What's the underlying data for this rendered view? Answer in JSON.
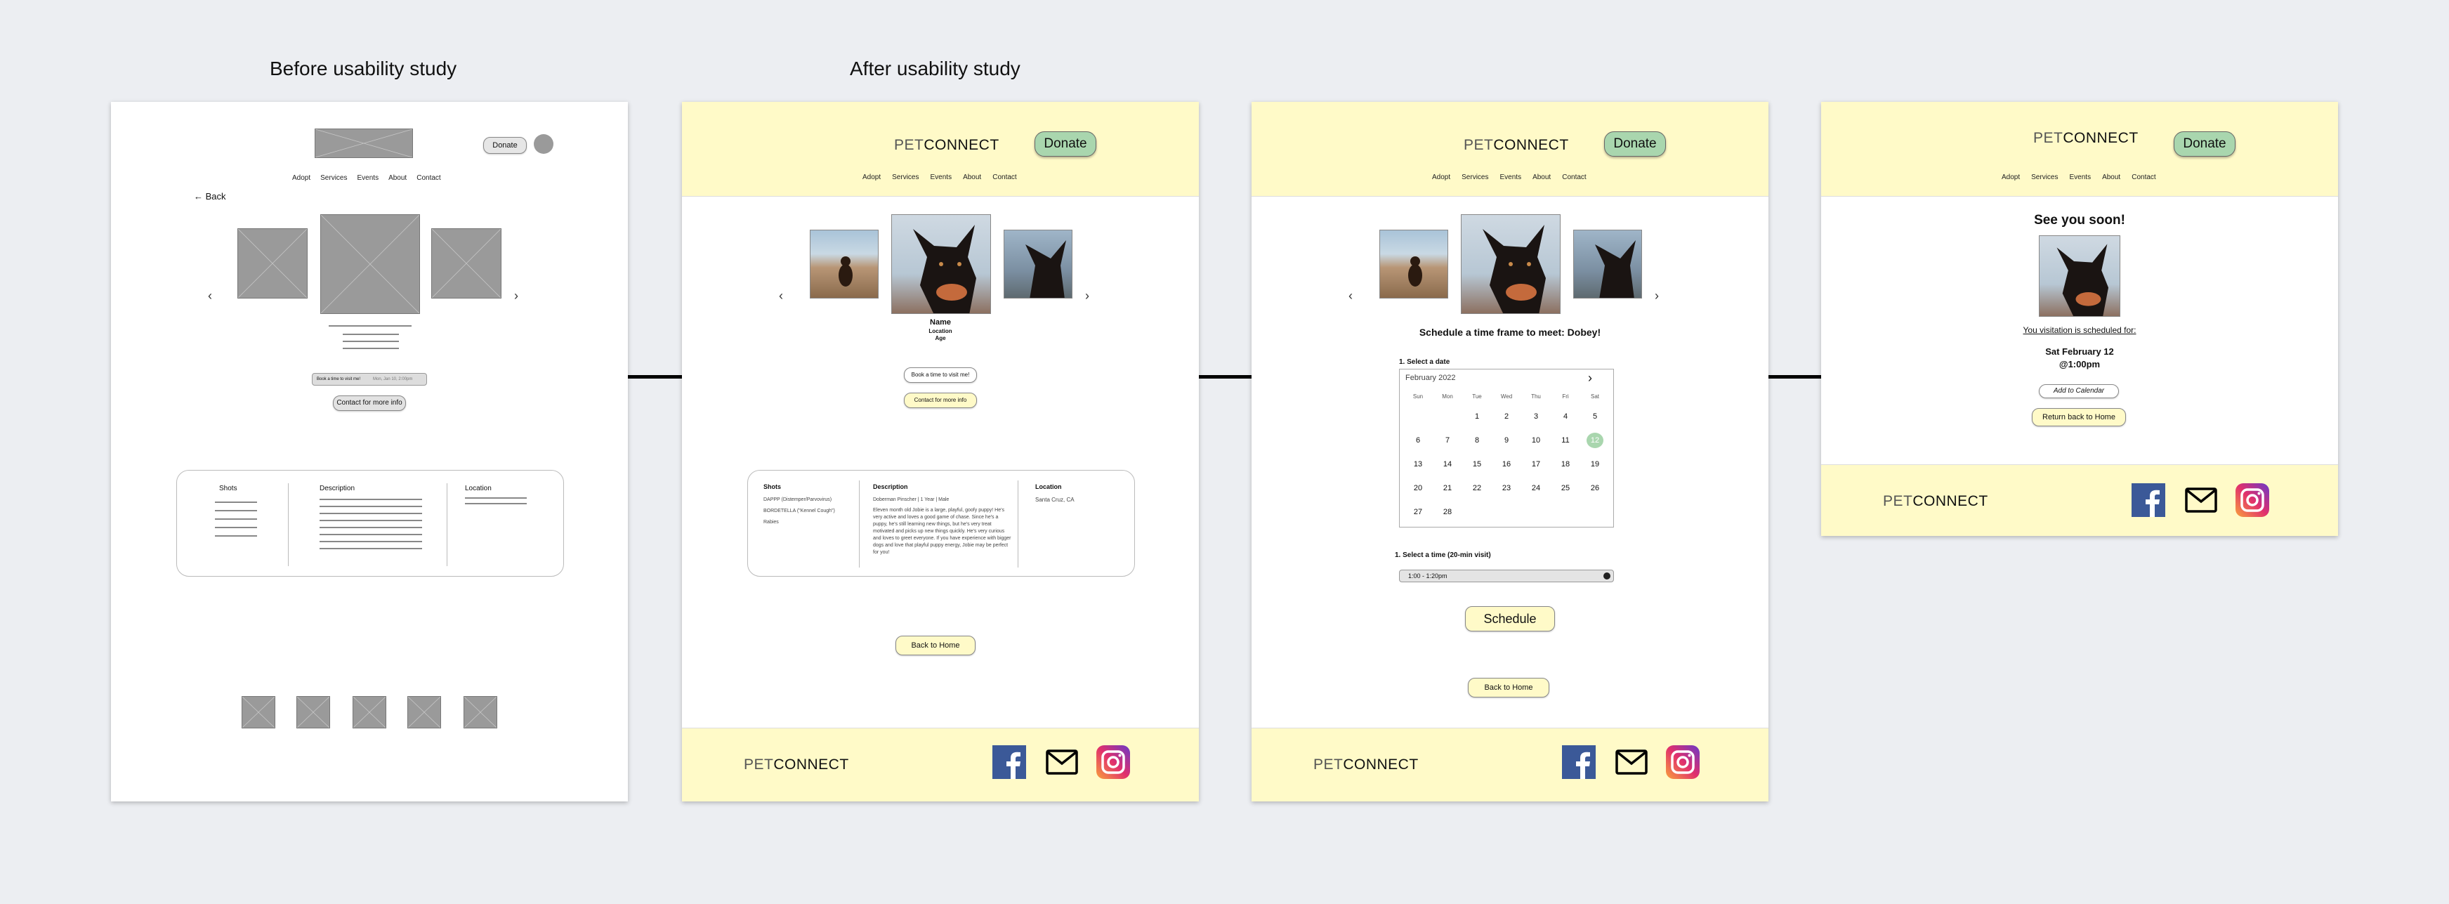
{
  "captions": {
    "before": "Before usability study",
    "after": "After usability study"
  },
  "brand": {
    "pet": "PET",
    "connect": "CONNECT"
  },
  "nav": [
    "Adopt",
    "Services",
    "Events",
    "About",
    "Contact"
  ],
  "donate_label": "Donate",
  "wireframe": {
    "back_label": "Back",
    "book_label": "Book a time to visit me!",
    "time_value": "Mon, Jan 10, 2:00pm",
    "contact_label": "Contact for more info",
    "col_shots": "Shots",
    "col_description": "Description",
    "col_location": "Location"
  },
  "profile": {
    "name": "Name",
    "location": "Location",
    "age": "Age",
    "book_label": "Book a time to visit me!",
    "contact_label": "Contact for more info",
    "col_shots": "Shots",
    "col_description": "Description",
    "col_location": "Location",
    "shots_lines": [
      "DAPPP (Distemper/Parvovirus)",
      "BORDETELLA (\"Kennel Cough\")",
      "Rabies"
    ],
    "description_sub": "Doberman Pinscher | 1 Year | Male",
    "description_text": "Eleven month old Jobie is a large, playful, goofy puppy! He's very active and loves a good game of chase. Since he's a puppy, he's still learning new things, but he's very treat motivated and picks up new things quickly. He's very curious and loves to greet everyone. If you have experience with bigger dogs and love that playful puppy energy, Jobie may be perfect for you!",
    "location_value": "Santa Cruz, CA",
    "back_home": "Back to Home"
  },
  "schedule": {
    "heading": "Schedule a time frame to meet: Dobey!",
    "step1": "1. Select a date",
    "month": "February 2022",
    "weekdays": [
      "Sun",
      "Mon",
      "Tue",
      "Wed",
      "Thu",
      "Fri",
      "Sat"
    ],
    "weeks": [
      [
        "",
        "",
        "1",
        "2",
        "3",
        "4",
        "5"
      ],
      [
        "6",
        "7",
        "8",
        "9",
        "10",
        "11",
        "12"
      ],
      [
        "13",
        "14",
        "15",
        "16",
        "17",
        "18",
        "19"
      ],
      [
        "20",
        "21",
        "22",
        "23",
        "24",
        "25",
        "26"
      ],
      [
        "27",
        "28",
        "",
        "",
        "",
        "",
        ""
      ]
    ],
    "selected_day": "12",
    "step2": "1. Select a time (20-min visit)",
    "time_value": "1:00 - 1:20pm",
    "schedule_label": "Schedule",
    "back_home": "Back to Home"
  },
  "confirm": {
    "heading": "See you soon!",
    "scheduled_for": "You visitation is scheduled for:",
    "date": "Sat February 12",
    "time": "@1:00pm",
    "add_calendar": "Add to Calendar",
    "return_home": "Return back to Home"
  },
  "colors": {
    "header_bg": "#fffac8",
    "donate_bg": "#a9d6ae",
    "selected_day": "#a9d6ae",
    "facebook": "#3b5998"
  }
}
